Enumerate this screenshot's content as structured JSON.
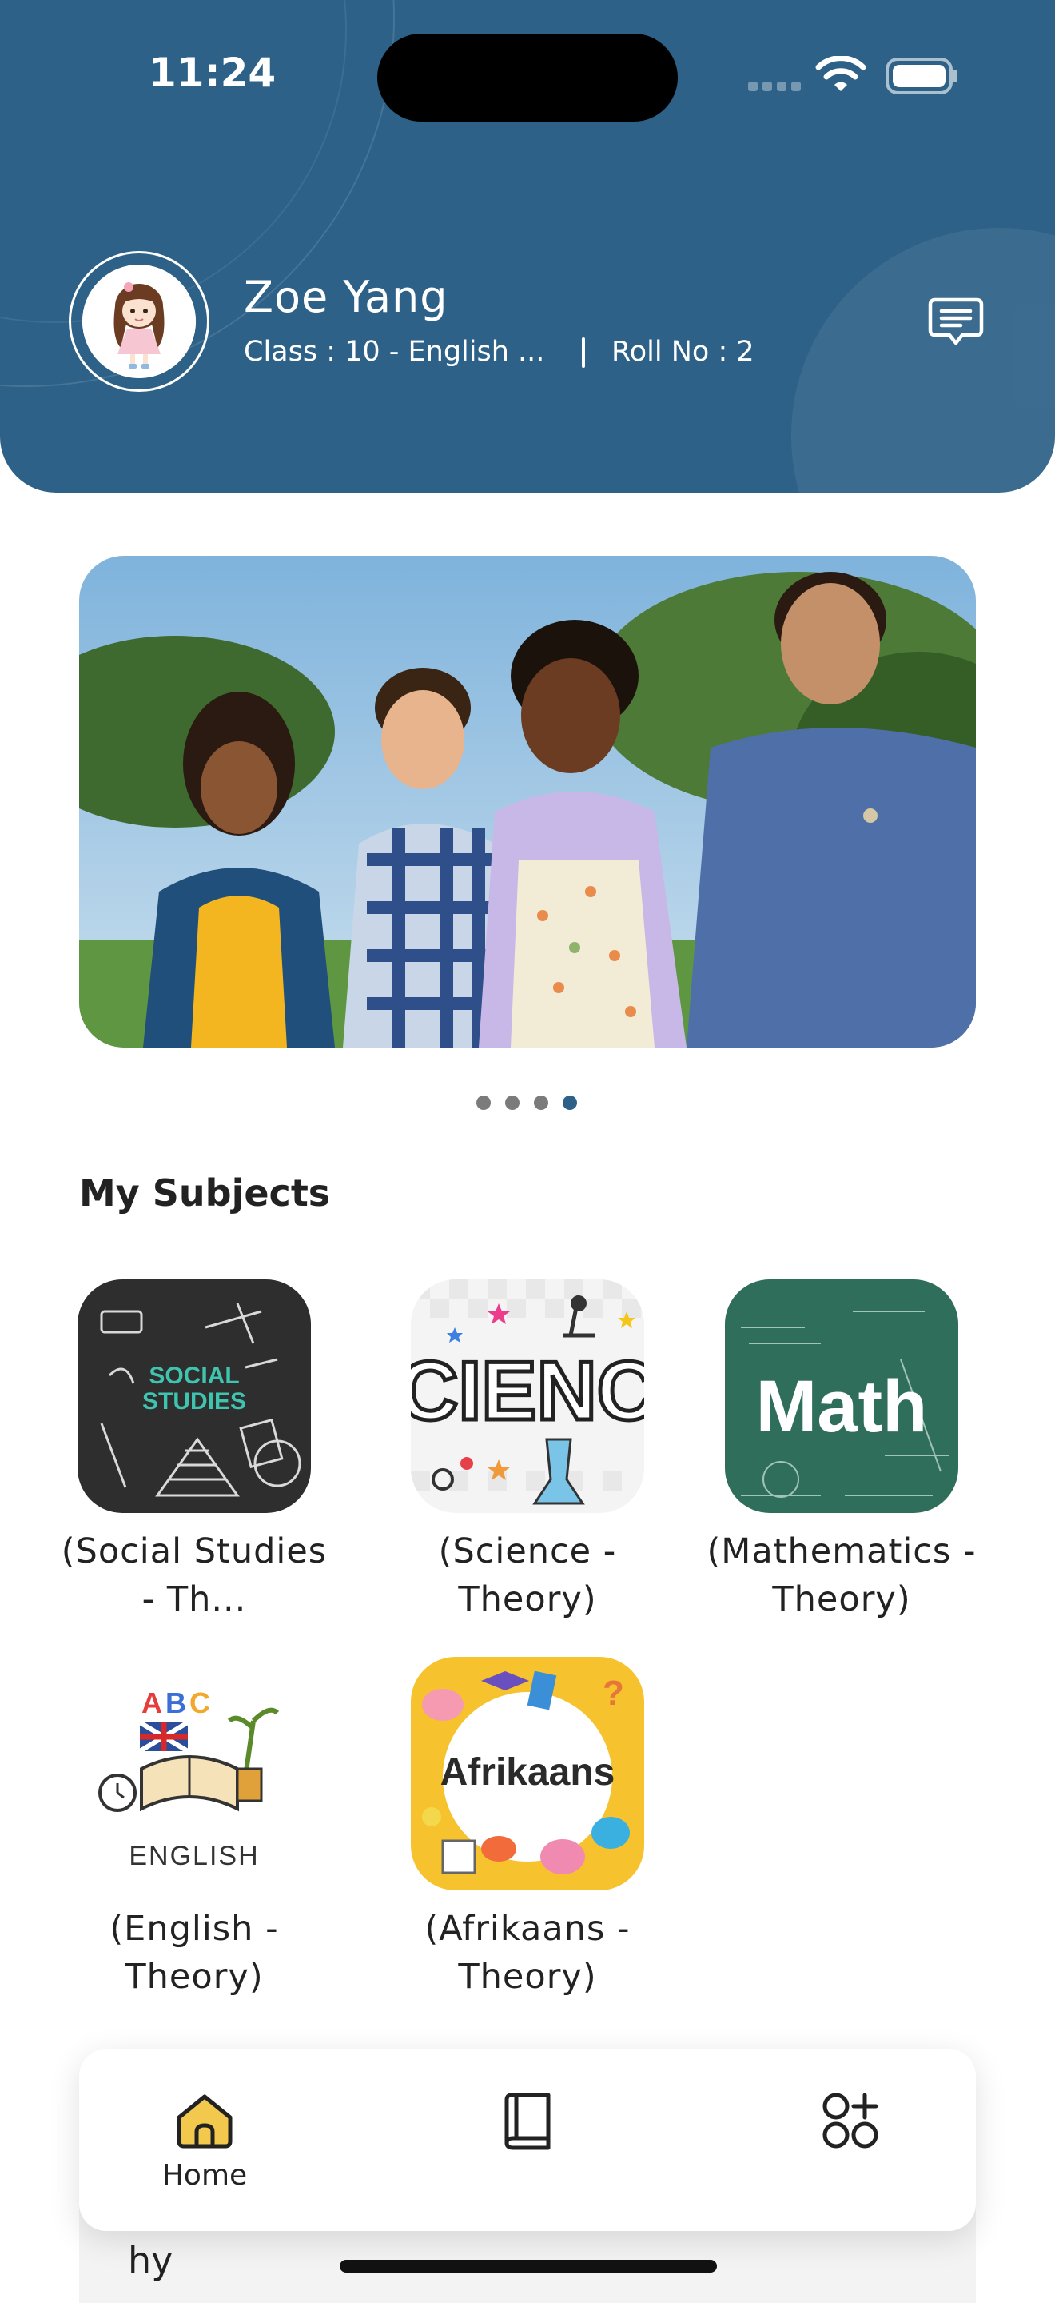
{
  "status_bar": {
    "time": "11:24"
  },
  "profile": {
    "name": "Zoe Yang",
    "class_info": "Class : 10 - English ...",
    "roll_info": "Roll No : 2"
  },
  "carousel": {
    "slide_count": 4,
    "active_index": 3
  },
  "subjects": {
    "title": "My Subjects",
    "items": [
      {
        "label": "(Social Studies - Th...",
        "art": "SOCIAL STUDIES"
      },
      {
        "label": "(Science - Theory)",
        "art": "CIENC"
      },
      {
        "label": "(Mathematics - Theory)",
        "art": "Math"
      },
      {
        "label": "(English - Theory)",
        "art": "ENGLISH"
      },
      {
        "label": "(Afrikaans - Theory)",
        "art": "Afrikaans"
      }
    ]
  },
  "bottom_nav": {
    "home_label": "Home",
    "peek_text": "hy"
  },
  "colors": {
    "primary": "#2d6188",
    "home_icon": "#f2c94c"
  }
}
